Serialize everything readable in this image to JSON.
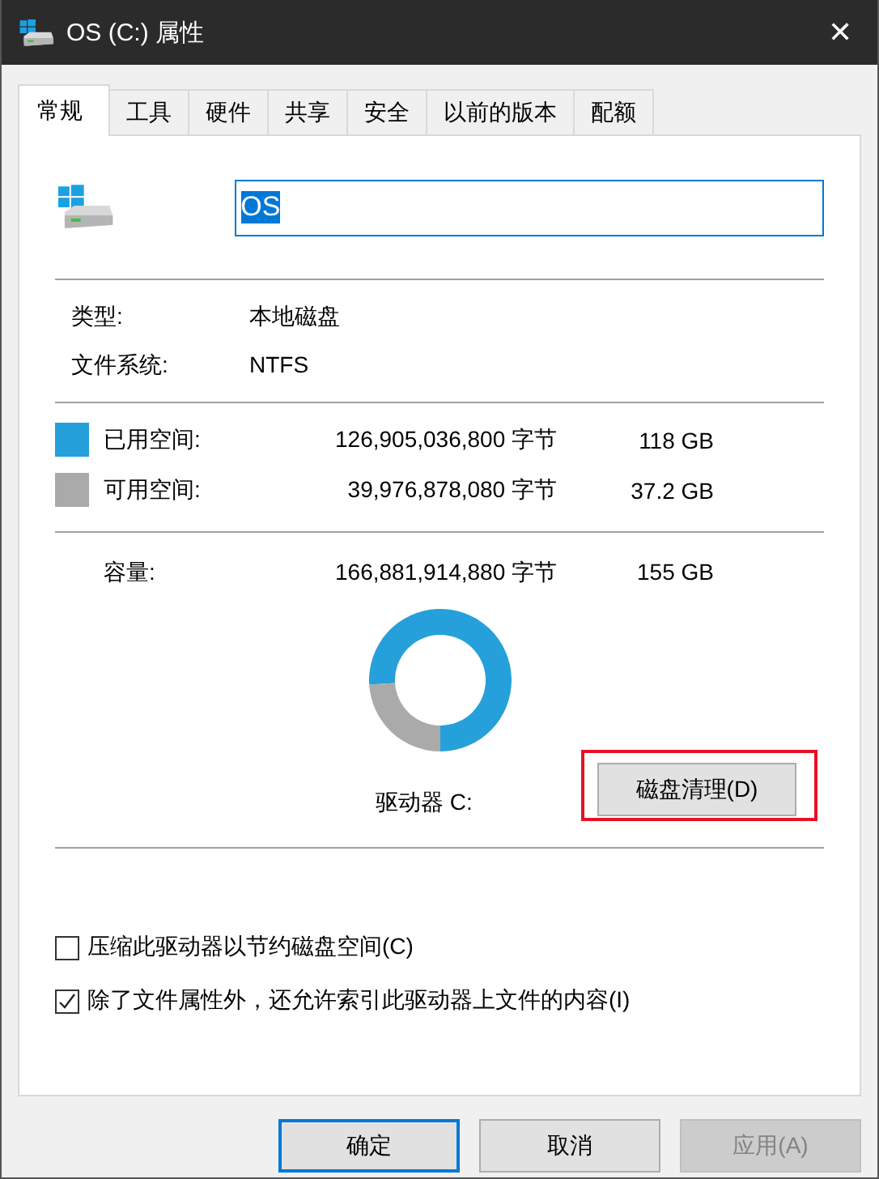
{
  "window": {
    "title": "OS (C:) 属性",
    "close": "✕"
  },
  "tabs": [
    {
      "label": "常规",
      "selected": true
    },
    {
      "label": "工具",
      "selected": false
    },
    {
      "label": "硬件",
      "selected": false
    },
    {
      "label": "共享",
      "selected": false
    },
    {
      "label": "安全",
      "selected": false
    },
    {
      "label": "以前的版本",
      "selected": false
    },
    {
      "label": "配额",
      "selected": false
    }
  ],
  "name_field": {
    "value": "OS",
    "text_selected": true
  },
  "info": [
    {
      "label": "类型:",
      "value": "本地磁盘"
    },
    {
      "label": "文件系统:",
      "value": "NTFS"
    }
  ],
  "space": [
    {
      "label": "已用空间:",
      "bytes": "126,905,036,800 字节",
      "size": "118 GB",
      "color": "#26a0da"
    },
    {
      "label": "可用空间:",
      "bytes": "39,976,878,080 字节",
      "size": "37.2 GB",
      "color": "#aaaaaa"
    }
  ],
  "capacity": {
    "label": "容量:",
    "bytes": "166,881,914,880 字节",
    "size": "155 GB"
  },
  "chart_data": {
    "type": "donut",
    "values": [
      76,
      24
    ]
  },
  "drive_label": "驱动器 C:",
  "cleanup_button": {
    "label": "磁盘清理(D)",
    "highlighted": true
  },
  "options": [
    {
      "label": "压缩此驱动器以节约磁盘空间(C)",
      "checked": false
    },
    {
      "label": "除了文件属性外，还允许索引此驱动器上文件的内容(I)",
      "checked": true
    }
  ],
  "buttons": [
    {
      "label": "确定",
      "default": true,
      "disabled": false
    },
    {
      "label": "取消",
      "default": false,
      "disabled": false
    },
    {
      "label": "应用(A)",
      "default": false,
      "disabled": true
    }
  ]
}
